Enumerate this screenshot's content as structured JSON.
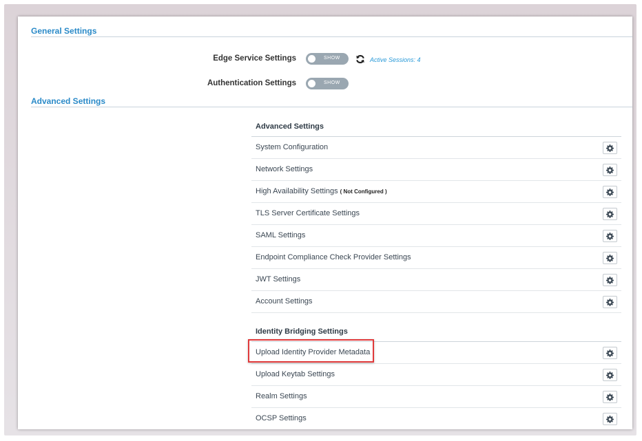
{
  "general": {
    "title": "General Settings",
    "edge_label": "Edge Service Settings",
    "edge_toggle": "SHOW",
    "active_sessions": "Active Sessions: 4",
    "auth_label": "Authentication Settings",
    "auth_toggle": "SHOW"
  },
  "advanced": {
    "title": "Advanced Settings",
    "table_header": "Advanced Settings",
    "rows": [
      {
        "label": "System Configuration"
      },
      {
        "label": "Network Settings"
      },
      {
        "label": "High Availability Settings",
        "tag": "( Not Configured )"
      },
      {
        "label": "TLS Server Certificate Settings"
      },
      {
        "label": "SAML Settings"
      },
      {
        "label": "Endpoint Compliance Check Provider Settings"
      },
      {
        "label": "JWT Settings"
      },
      {
        "label": "Account Settings"
      }
    ]
  },
  "identity": {
    "table_header": "Identity Bridging Settings",
    "rows": [
      {
        "label": "Upload Identity Provider Metadata"
      },
      {
        "label": "Upload Keytab Settings"
      },
      {
        "label": "Realm Settings"
      },
      {
        "label": "OCSP Settings"
      }
    ]
  },
  "colors": {
    "section_title": "#2a8ac8",
    "toggle_bg": "#9aa7b1",
    "sessions_link": "#2a9ad8",
    "highlight": "#e0393a"
  },
  "icons": {
    "row_action": "gear-icon",
    "refresh": "refresh-icon"
  }
}
